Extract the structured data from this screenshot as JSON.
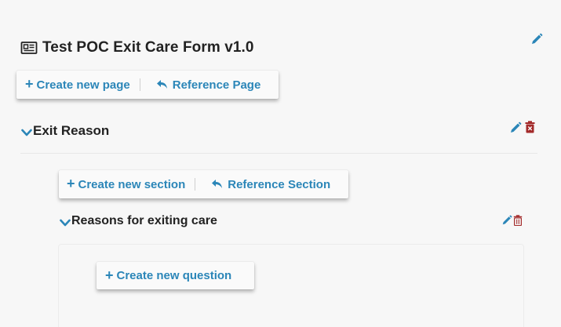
{
  "form": {
    "title": "Test POC Exit Care Form v1.0",
    "icon": "form-icon"
  },
  "page_toolbar": {
    "create_label": "Create new page",
    "reference_label": "Reference Page"
  },
  "page": {
    "title": "Exit Reason"
  },
  "section_toolbar": {
    "create_label": "Create new section",
    "reference_label": "Reference Section"
  },
  "section": {
    "title": "Reasons for exiting care"
  },
  "question_toolbar": {
    "create_label": "Create new question"
  },
  "colors": {
    "accent": "#2b86b8",
    "danger": "#a32a2a",
    "background": "#f7f7f7"
  }
}
